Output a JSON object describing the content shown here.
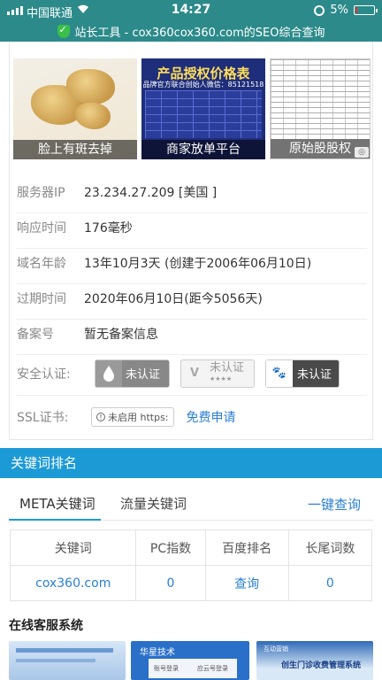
{
  "status": {
    "carrier": "中国联通",
    "time": "14:27",
    "battery": "5%"
  },
  "url_bar": {
    "title": "站长工具 - cox360cox360.com的SEO综合查询"
  },
  "ads": [
    {
      "caption": "脸上有斑去掉"
    },
    {
      "caption": "商家放单平台",
      "title": "产品授权价格表",
      "subtitle": "品牌官方联合创始人微信：85121518"
    },
    {
      "caption": "原始股股权"
    }
  ],
  "info": {
    "server_ip": {
      "label": "服务器IP",
      "value": "23.234.27.209 [美国 ]"
    },
    "response": {
      "label": "响应时间",
      "value": "176毫秒"
    },
    "domain_age": {
      "label": "域名年龄",
      "value": "13年10月3天 (创建于2006年06月10日)"
    },
    "expire": {
      "label": "过期时间",
      "date": "2020年06月10日",
      "remain": "(距今5056天)"
    },
    "icp": {
      "label": "备案号",
      "value": "暂无备案信息"
    },
    "security": {
      "label": "安全认证:",
      "badges": [
        "未认证",
        "未认证",
        "未认证"
      ],
      "stars": "★★★★"
    },
    "ssl": {
      "label": "SSL证书:",
      "badge": "未启用 https:",
      "apply": "免费申请"
    }
  },
  "keywords": {
    "section_title": "关键词排名",
    "tabs": [
      "META关键词",
      "流量关键词"
    ],
    "query_link": "一键查询",
    "columns": [
      "关键词",
      "PC指数",
      "百度排名",
      "长尾词数"
    ],
    "rows": [
      {
        "keyword": "cox360.com",
        "pc_index": "0",
        "baidu_rank": "查询",
        "longtail": "0"
      }
    ]
  },
  "services": {
    "title": "在线客服系统",
    "items": [
      {
        "logo": ""
      },
      {
        "logo": "华星技术",
        "fields": [
          "账号登录",
          "应云号登录"
        ]
      },
      {
        "tag": "互动营销",
        "name": "创生门诊收费管理系统"
      }
    ]
  },
  "colors": {
    "topbar": "#2c8a8a",
    "section_bar": "#1c9ad6",
    "link": "#2a7fd4",
    "warn": "#e03030"
  }
}
